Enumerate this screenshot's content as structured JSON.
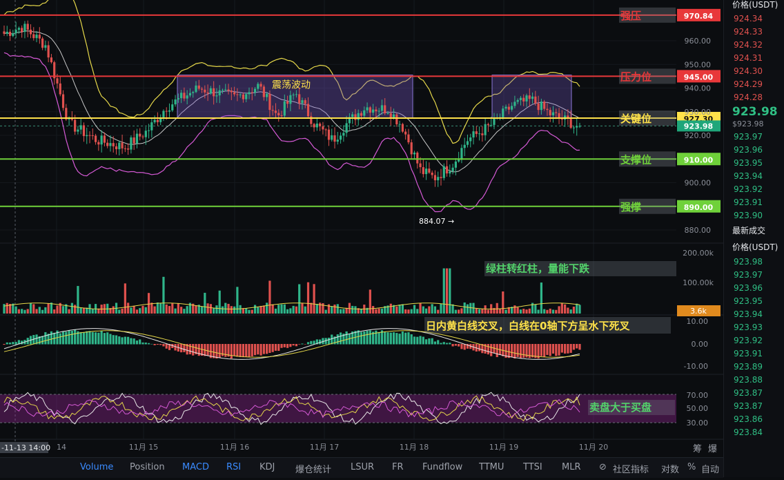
{
  "chart_data": {
    "type": "candlestick",
    "price_axis": {
      "ticks": [
        "960.00",
        "950.00",
        "940.00",
        "930.00",
        "920.00",
        "900.00",
        "890.00",
        "880.00"
      ],
      "range": [
        876,
        975
      ]
    },
    "time_axis": {
      "ticks": [
        "11月 14",
        "11月 15",
        "11月 16",
        "11月 17",
        "11月 18",
        "11月 19",
        "11月 20"
      ],
      "crosshair_label": "-11-13 14:00"
    },
    "levels": [
      {
        "label": "强压",
        "price": 970.84,
        "tag": "970.84",
        "color": "#e8383a"
      },
      {
        "label": "压力位",
        "price": 945.0,
        "tag": "945.00",
        "color": "#e8383a"
      },
      {
        "label": "关键位",
        "price": 927.3,
        "tag": "927.30",
        "color": "#ffe24a"
      },
      {
        "label": "支撑位",
        "price": 910.0,
        "tag": "910.00",
        "color": "#6fd13a"
      },
      {
        "label": "强撑",
        "price": 890.0,
        "tag": "890.00",
        "color": "#6fd13a"
      }
    ],
    "current_price": {
      "value": 923.98,
      "tag": "923.98",
      "color": "#1fa67a"
    },
    "boxes": [
      {
        "label": "震荡波动"
      }
    ],
    "low_marker": "884.07",
    "volume": {
      "ticks": [
        "200.00k",
        "100.00k"
      ],
      "last": "3.6k"
    },
    "macd": {
      "ticks": [
        "10.00",
        "0.00",
        "-10.00"
      ]
    },
    "rsi": {
      "ticks": [
        "70.00",
        "50.00",
        "30.00"
      ]
    },
    "annotations": [
      {
        "text": "绿柱转红柱，量能下跌",
        "color": "#53d36b"
      },
      {
        "text": "日内黄白线交叉，白线在0轴下方呈水下死叉",
        "color": "#ffe24a"
      },
      {
        "text": "卖盘大于买盘",
        "color": "#53d36b"
      }
    ],
    "colors": {
      "up": "#2fb58a",
      "down": "#e0514e",
      "boll_upper": "#e6d84a",
      "boll_mid": "#c8c8c8",
      "boll_lower": "#d65ad6"
    }
  },
  "orderbook": {
    "header": "价格(USDT)",
    "asks": [
      "924.34",
      "924.33",
      "924.32",
      "924.31",
      "924.30",
      "924.29",
      "924.28"
    ],
    "last": "923.98",
    "mark": "$923.98",
    "bids": [
      "923.97",
      "923.96",
      "923.95",
      "923.94",
      "923.92",
      "923.91",
      "923.90"
    ],
    "trades_title": "最新成交",
    "trades_header": "价格(USDT)",
    "trades": [
      "923.98",
      "923.97",
      "923.96",
      "923.95",
      "923.94",
      "923.93",
      "923.92",
      "923.91",
      "923.89",
      "923.88",
      "923.87",
      "923.87",
      "923.86",
      "923.84"
    ]
  },
  "toolbar": {
    "items": [
      "Volume",
      "Position",
      "MACD",
      "RSI",
      "KDJ",
      "爆仓统计",
      "LSUR",
      "FR",
      "Fundflow",
      "TTMU",
      "TTSI",
      "MLR"
    ],
    "right": [
      "社区指标",
      "对数",
      "%",
      "自动"
    ],
    "corner": [
      "筹",
      "爆"
    ]
  }
}
